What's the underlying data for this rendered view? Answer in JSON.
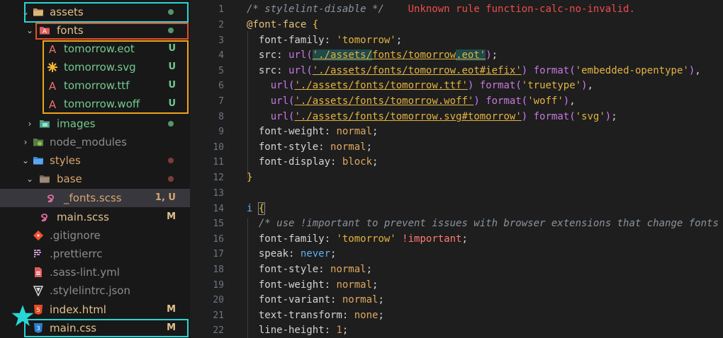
{
  "explorer": {
    "items": [
      {
        "label": "assets",
        "badge": "",
        "status": "dot-green",
        "color": "#e2c08d"
      },
      {
        "label": "fonts",
        "badge": "",
        "status": "dot-green",
        "color": "#e2c08d"
      },
      {
        "label": "tomorrow.eot",
        "badge": "U",
        "color": "#73c991"
      },
      {
        "label": "tomorrow.svg",
        "badge": "U",
        "color": "#73c991"
      },
      {
        "label": "tomorrow.ttf",
        "badge": "U",
        "color": "#73c991"
      },
      {
        "label": "tomorrow.woff",
        "badge": "U",
        "color": "#73c991"
      },
      {
        "label": "images",
        "badge": "",
        "status": "dot-green",
        "color": "#73c991"
      },
      {
        "label": "node_modules",
        "badge": "",
        "color": "#8c8c8c"
      },
      {
        "label": "styles",
        "badge": "",
        "status": "dot-red",
        "color": "#d7a56f"
      },
      {
        "label": "base",
        "badge": "",
        "status": "dot-red",
        "color": "#d7a56f"
      },
      {
        "label": "_fonts.scss",
        "badge": "1, U",
        "color": "#d7a56f"
      },
      {
        "label": "main.scss",
        "badge": "M",
        "color": "#e2c08d"
      },
      {
        "label": ".gitignore",
        "badge": "",
        "color": "#8c8c8c"
      },
      {
        "label": ".prettierrc",
        "badge": "",
        "color": "#8c8c8c"
      },
      {
        "label": ".sass-lint.yml",
        "badge": "",
        "color": "#8c8c8c"
      },
      {
        "label": ".stylelintrc.json",
        "badge": "",
        "color": "#8c8c8c"
      },
      {
        "label": "index.html",
        "badge": "M",
        "color": "#e2c08d"
      },
      {
        "label": "main.css",
        "badge": "M",
        "color": "#e2c08d"
      }
    ]
  },
  "editor": {
    "error_message": "Unknown rule function-calc-no-invalid.",
    "line_numbers": [
      "1",
      "2",
      "3",
      "4",
      "5",
      "6",
      "7",
      "8",
      "9",
      "10",
      "11",
      "12",
      "13",
      "14",
      "15",
      "16",
      "17",
      "18",
      "19",
      "20",
      "21",
      "22"
    ]
  },
  "colors": {
    "highlight_cyan": "#2ad4d4",
    "highlight_red": "#e0512a",
    "highlight_orange": "#f0a31a",
    "star": "#2ad4d4"
  }
}
